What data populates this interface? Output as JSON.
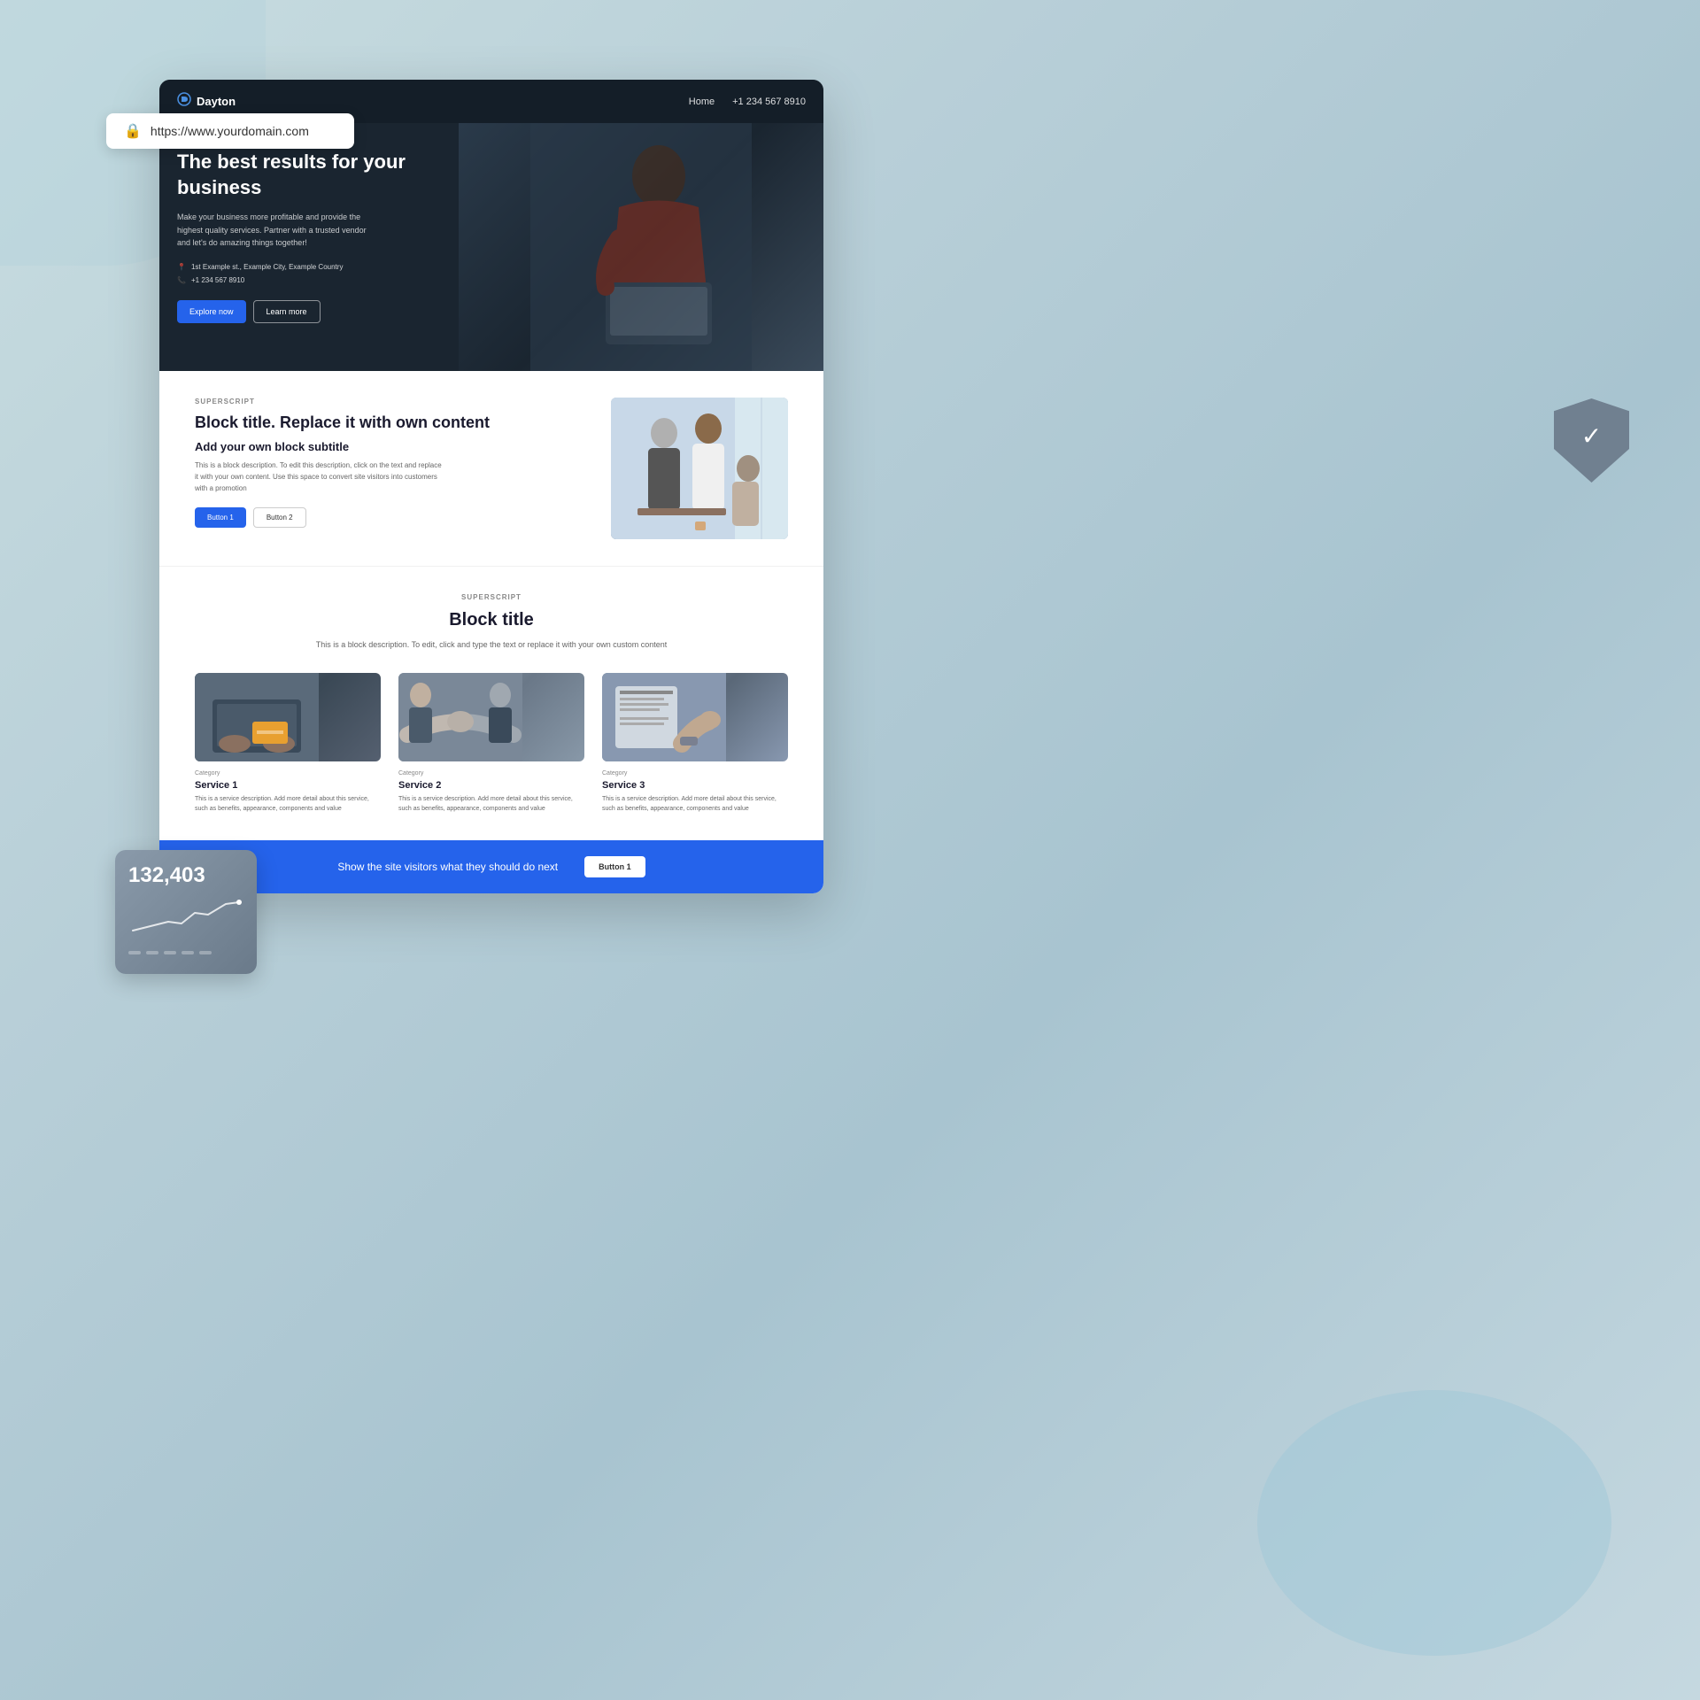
{
  "page": {
    "background": "#c0d5dc",
    "url": "https://www.yourdomain.com"
  },
  "urlbar": {
    "url": "https://www.yourdomain.com",
    "lock_icon": "🔒"
  },
  "nav": {
    "logo_text": "Dayton",
    "logo_icon": "D",
    "home_link": "Home",
    "phone": "+1 234 567 8910"
  },
  "hero": {
    "title": "The best results for your business",
    "description": "Make your business more profitable and provide the highest quality services. Partner with a trusted vendor and let's do amazing things together!",
    "address": "1st Example st., Example City, Example Country",
    "phone": "+1 234 567 8910",
    "btn_explore": "Explore now",
    "btn_learn": "Learn more"
  },
  "block1": {
    "superscript": "SUPERSCRIPT",
    "title": "Block title. Replace it with own content",
    "subtitle": "Add your own block subtitle",
    "description": "This is a block description. To edit this description, click on the text and replace it with your own content. Use this space to convert site visitors into customers with a promotion",
    "btn1": "Button 1",
    "btn2": "Button 2"
  },
  "block2": {
    "superscript": "SUPERSCRIPT",
    "title": "Block title",
    "description": "This is a block description. To edit, click and type the text or replace it with your own custom content",
    "services": [
      {
        "category": "Category",
        "name": "Service 1",
        "description": "This is a service description. Add more detail about this service, such as benefits, appearance, components and value"
      },
      {
        "category": "Category",
        "name": "Service 2",
        "description": "This is a service description. Add more detail about this service, such as benefits, appearance, components and value"
      },
      {
        "category": "Category",
        "name": "Service 3",
        "description": "This is a service description. Add more detail about this service, such as benefits, appearance, components and value"
      }
    ]
  },
  "cta": {
    "text": "Show the site visitors what they should do next",
    "button": "Button 1"
  },
  "stats": {
    "number": "132,403"
  }
}
